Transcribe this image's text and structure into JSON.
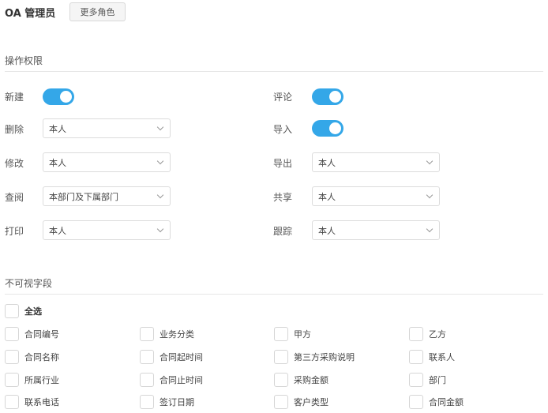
{
  "header": {
    "role_name": "OA 管理员",
    "more_roles_label": "更多角色"
  },
  "permissions": {
    "title": "操作权限",
    "left": [
      {
        "label": "新建",
        "type": "toggle",
        "on": true
      },
      {
        "label": "删除",
        "type": "select",
        "value": "本人"
      },
      {
        "label": "修改",
        "type": "select",
        "value": "本人"
      },
      {
        "label": "查阅",
        "type": "select",
        "value": "本部门及下属部门"
      },
      {
        "label": "打印",
        "type": "select",
        "value": "本人"
      }
    ],
    "right": [
      {
        "label": "评论",
        "type": "toggle",
        "on": true
      },
      {
        "label": "导入",
        "type": "toggle",
        "on": true
      },
      {
        "label": "导出",
        "type": "select",
        "value": "本人"
      },
      {
        "label": "共享",
        "type": "select",
        "value": "本人"
      },
      {
        "label": "跟踪",
        "type": "select",
        "value": "本人"
      }
    ]
  },
  "fields": {
    "title": "不可视字段",
    "select_all_label": "全选",
    "rows": [
      [
        "合同编号",
        "业务分类",
        "甲方",
        "乙方"
      ],
      [
        "合同名称",
        "合同起时间",
        "第三方采购说明",
        "联系人"
      ],
      [
        "所属行业",
        "合同止时间",
        "采购金额",
        "部门"
      ],
      [
        "联系电话",
        "签订日期",
        "客户类型",
        "合同金额"
      ]
    ]
  },
  "colors": {
    "toggle_on": "#34a7e8"
  }
}
